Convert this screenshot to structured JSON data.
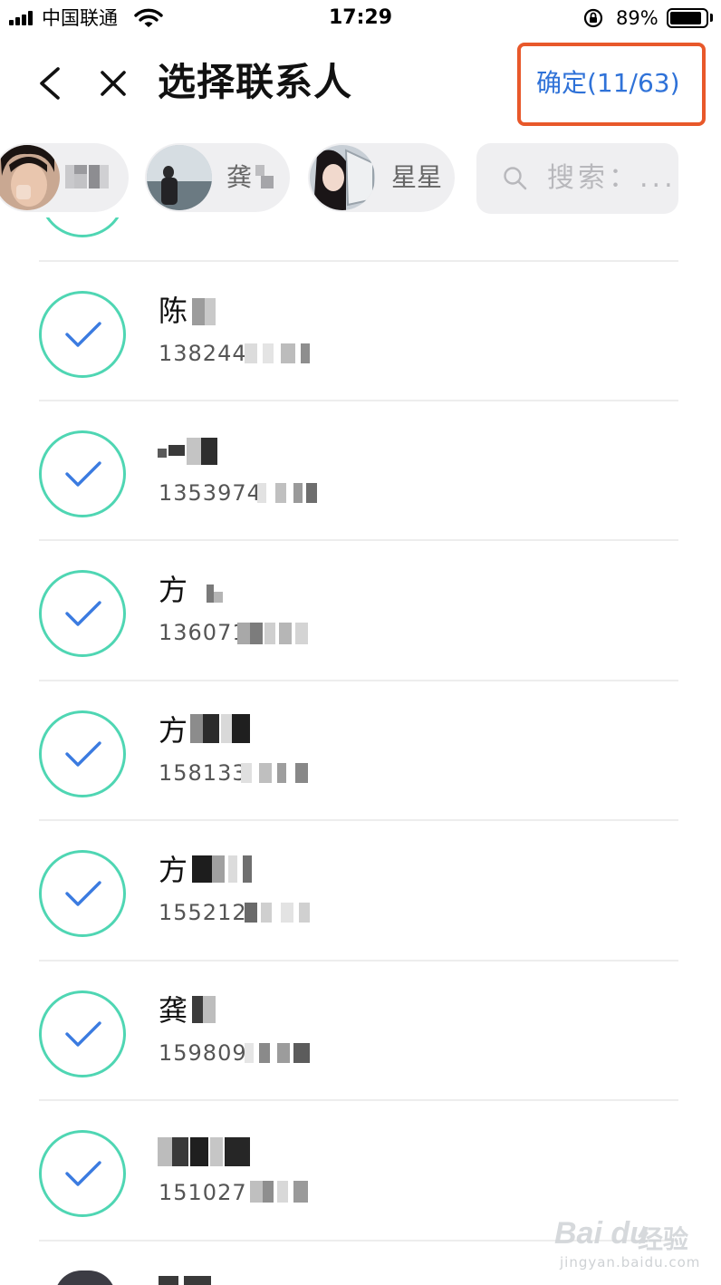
{
  "status_bar": {
    "carrier": "中国联通",
    "time": "17:29",
    "battery_percent": "89%",
    "battery_level": 0.89,
    "icons": [
      "signal-icon",
      "wifi-icon",
      "orientation-lock-icon",
      "battery-icon"
    ]
  },
  "nav": {
    "back_icon": "chevron-left-icon",
    "close_icon": "close-icon",
    "title": "选择联系人",
    "confirm_label": "确定(11/63)",
    "highlight_color": "#e8582a",
    "confirm_color": "#2f72d8"
  },
  "selected_chips": [
    {
      "name": ""
    },
    {
      "name": "龚"
    },
    {
      "name": "星星"
    }
  ],
  "search": {
    "placeholder": "搜索：...",
    "icon": "search-icon"
  },
  "contacts": [
    {
      "name": "陈",
      "phone": "138244",
      "checked": true
    },
    {
      "name": "",
      "phone": "1353974",
      "checked": true
    },
    {
      "name": "方",
      "phone": "136071",
      "checked": true
    },
    {
      "name": "方",
      "phone": "158133",
      "checked": true
    },
    {
      "name": "方",
      "phone": "155212",
      "checked": true
    },
    {
      "name": "龚",
      "phone": "159809",
      "checked": true
    },
    {
      "name": "",
      "phone": "151027",
      "checked": true
    }
  ],
  "colors": {
    "check_ring": "#4fd6b3",
    "check_mark": "#3b7be0",
    "chip_bg": "#efeff1"
  },
  "watermark": {
    "brand": "Bai du",
    "brand_cn": "经验",
    "url": "jingyan.baidu.com"
  }
}
